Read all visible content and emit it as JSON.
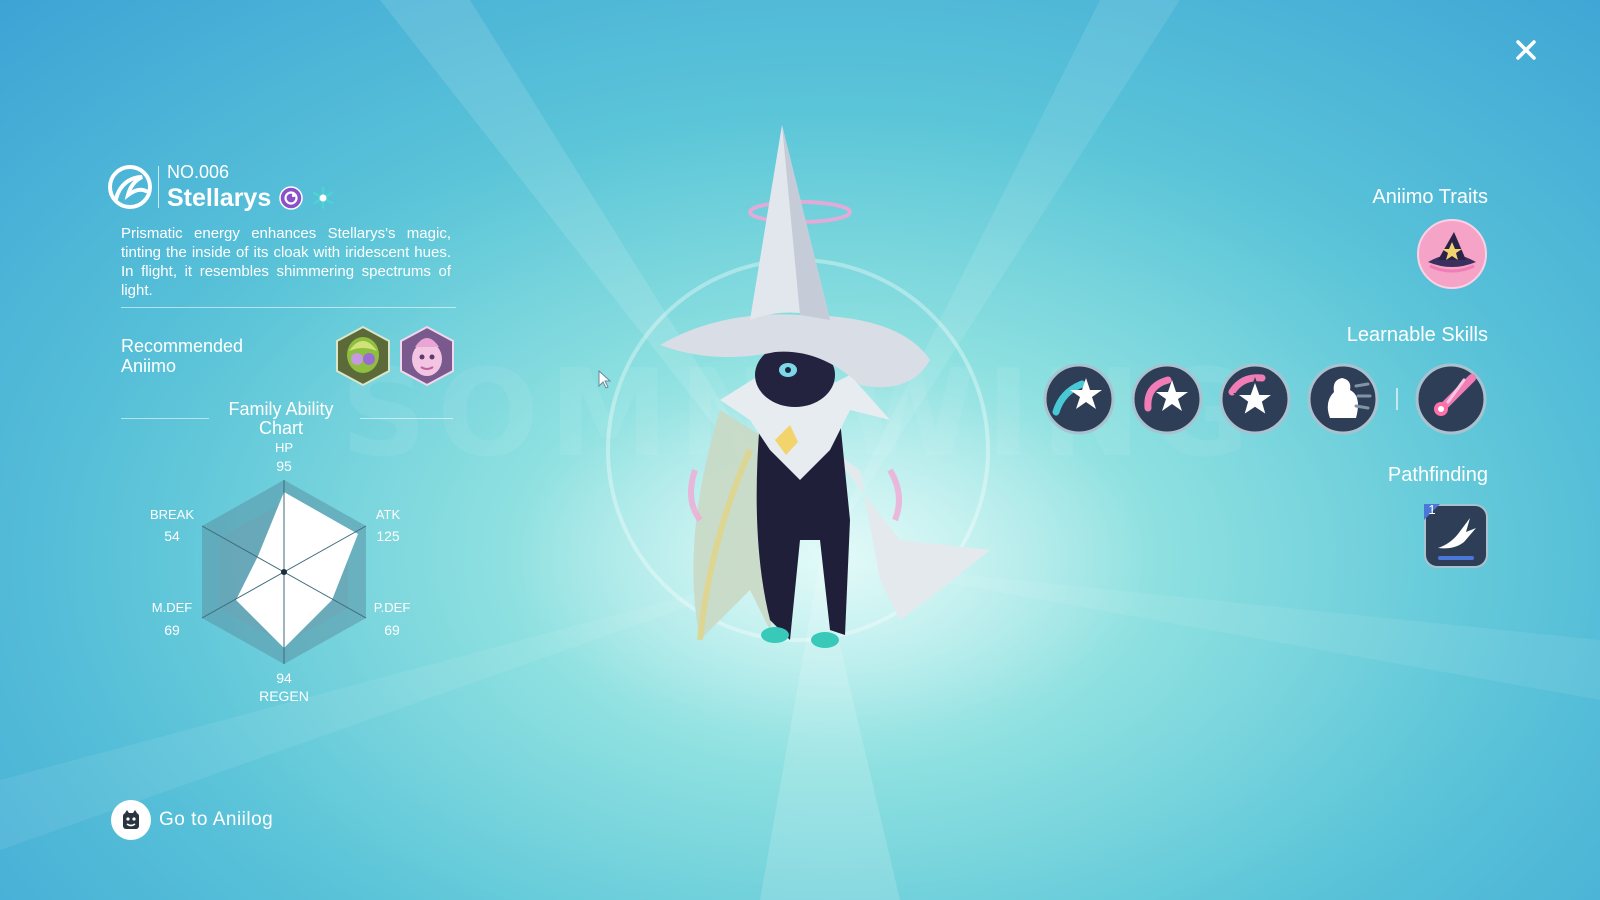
{
  "close_label": "×",
  "header": {
    "number": "NO.006",
    "name": "Stellarys"
  },
  "description": "Prismatic energy enhances Stellarys's magic, tinting the inside of its cloak with iridescent hues. In flight, it resembles shimmering spectrums of light.",
  "recommended": {
    "label_line1": "Recommended",
    "label_line2": "Aniimo"
  },
  "family_chart": {
    "title_line1": "Family Ability",
    "title_line2": "Chart",
    "stats": {
      "hp": {
        "label": "HP",
        "value": "95"
      },
      "atk": {
        "label": "ATK",
        "value": "125"
      },
      "pdef": {
        "label": "P.DEF",
        "value": "69"
      },
      "regen": {
        "label": "REGEN",
        "value": "94"
      },
      "mdef": {
        "label": "M.DEF",
        "value": "69"
      },
      "break": {
        "label": "BREAK",
        "value": "54"
      }
    }
  },
  "goto": {
    "label": "Go to Aniilog"
  },
  "right": {
    "traits_title": "Aniimo Traits",
    "skills_title": "Learnable Skills",
    "pathfinding_title": "Pathfinding",
    "pathfinding_badge": "1"
  },
  "watermark": "SOMNIWING",
  "colors": {
    "accent_pink": "#f5a3c7",
    "skill_dark": "#2f3e57",
    "type_purple": "#8a4fc9",
    "type_cyan": "#49d6d2"
  }
}
